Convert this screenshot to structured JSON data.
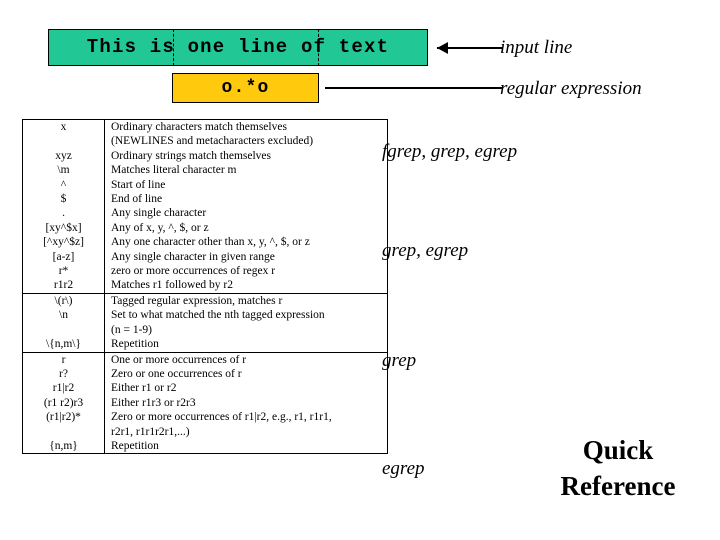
{
  "demo": {
    "input_line": "This is one line of text",
    "regex": "o.*o",
    "input_line_label": "input line",
    "regex_label": "regular expression",
    "input_box_color": "#21C896",
    "regex_box_color": "#FFC90E"
  },
  "table": {
    "sections": [
      {
        "rows": [
          {
            "pattern": "x",
            "desc": "Ordinary characters match themselves"
          },
          {
            "pattern": "",
            "desc": "(NEWLINES and metacharacters excluded)"
          },
          {
            "pattern": "xyz",
            "desc": "Ordinary strings match themselves"
          },
          {
            "pattern": "\\m",
            "desc": "Matches literal character m"
          },
          {
            "pattern": "^",
            "desc": "Start of line"
          },
          {
            "pattern": "$",
            "desc": "End of line"
          },
          {
            "pattern": ".",
            "desc": "Any single character"
          },
          {
            "pattern": "[xy^$x]",
            "desc": "Any of x, y, ^, $, or z"
          },
          {
            "pattern": "[^xy^$z]",
            "desc": "Any one character other than x, y, ^, $, or z"
          },
          {
            "pattern": "[a-z]",
            "desc": "Any single character in given range"
          },
          {
            "pattern": "r*",
            "desc": "zero or more occurrences of regex r"
          },
          {
            "pattern": "r1r2",
            "desc": "Matches r1 followed by r2"
          }
        ]
      },
      {
        "rows": [
          {
            "pattern": "\\(r\\)",
            "desc": "Tagged regular expression, matches r"
          },
          {
            "pattern": "\\n",
            "desc": "Set to what matched the nth tagged expression"
          },
          {
            "pattern": "",
            "desc": "(n = 1-9)"
          },
          {
            "pattern": "\\{n,m\\}",
            "desc": "Repetition"
          }
        ]
      },
      {
        "rows": [
          {
            "pattern": "r",
            "desc": "One or more occurrences of r"
          },
          {
            "pattern": "r?",
            "desc": "Zero or one occurrences of r"
          },
          {
            "pattern": "r1|r2",
            "desc": "Either r1 or r2"
          },
          {
            "pattern": "(r1 r2)r3",
            "desc": "Either r1r3 or r2r3"
          },
          {
            "pattern": "(r1|r2)*",
            "desc": "Zero or more occurrences of r1|r2, e.g., r1, r1r1,"
          },
          {
            "pattern": "",
            "desc": "r2r1, r1r1r2r1,...)"
          },
          {
            "pattern": "{n,m}",
            "desc": "Repetition"
          }
        ]
      }
    ]
  },
  "commands": {
    "fgrep_grep_egrep": "fgrep, grep, egrep",
    "grep_egrep": "grep, egrep",
    "grep": "grep",
    "egrep": "egrep"
  },
  "title": {
    "line1": "Quick",
    "line2": "Reference"
  }
}
